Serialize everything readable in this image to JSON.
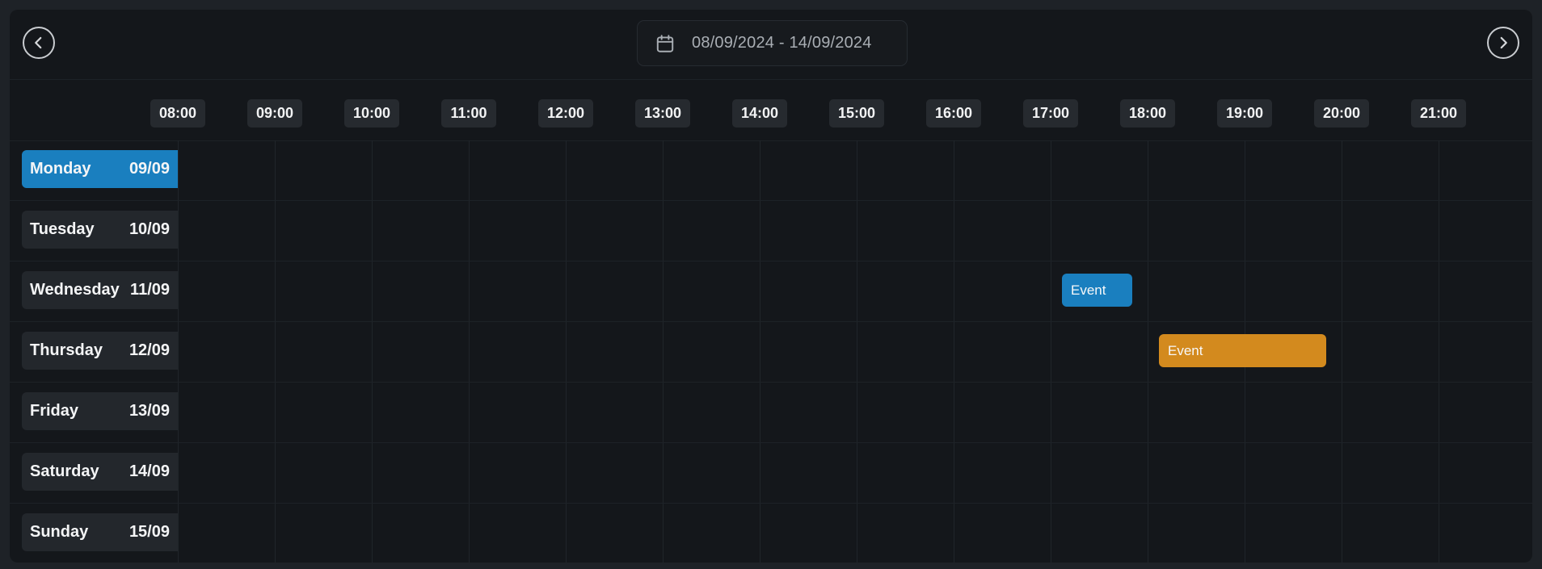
{
  "header": {
    "date_range": "08/09/2024 - 14/09/2024",
    "icons": {
      "prev": "chevron-left-icon",
      "next": "chevron-right-icon",
      "calendar": "calendar-icon"
    }
  },
  "times": [
    "08:00",
    "09:00",
    "10:00",
    "11:00",
    "12:00",
    "13:00",
    "14:00",
    "15:00",
    "16:00",
    "17:00",
    "18:00",
    "19:00",
    "20:00",
    "21:00"
  ],
  "days": [
    {
      "name": "Monday",
      "date": "09/09",
      "active": true
    },
    {
      "name": "Tuesday",
      "date": "10/09",
      "active": false
    },
    {
      "name": "Wednesday",
      "date": "11/09",
      "active": false
    },
    {
      "name": "Thursday",
      "date": "12/09",
      "active": false
    },
    {
      "name": "Friday",
      "date": "13/09",
      "active": false
    },
    {
      "name": "Saturday",
      "date": "14/09",
      "active": false
    },
    {
      "name": "Sunday",
      "date": "15/09",
      "active": false
    }
  ],
  "events": [
    {
      "label": "Event",
      "day": 2,
      "start": "17:00",
      "end": "17:45",
      "color": "#1a7fbf"
    },
    {
      "label": "Event",
      "day": 3,
      "start": "18:00",
      "end": "19:45",
      "color": "#d38a1e"
    }
  ],
  "colors": {
    "accent_blue": "#1a7fbf",
    "accent_orange": "#d38a1e",
    "panel_bg": "#14171b"
  }
}
